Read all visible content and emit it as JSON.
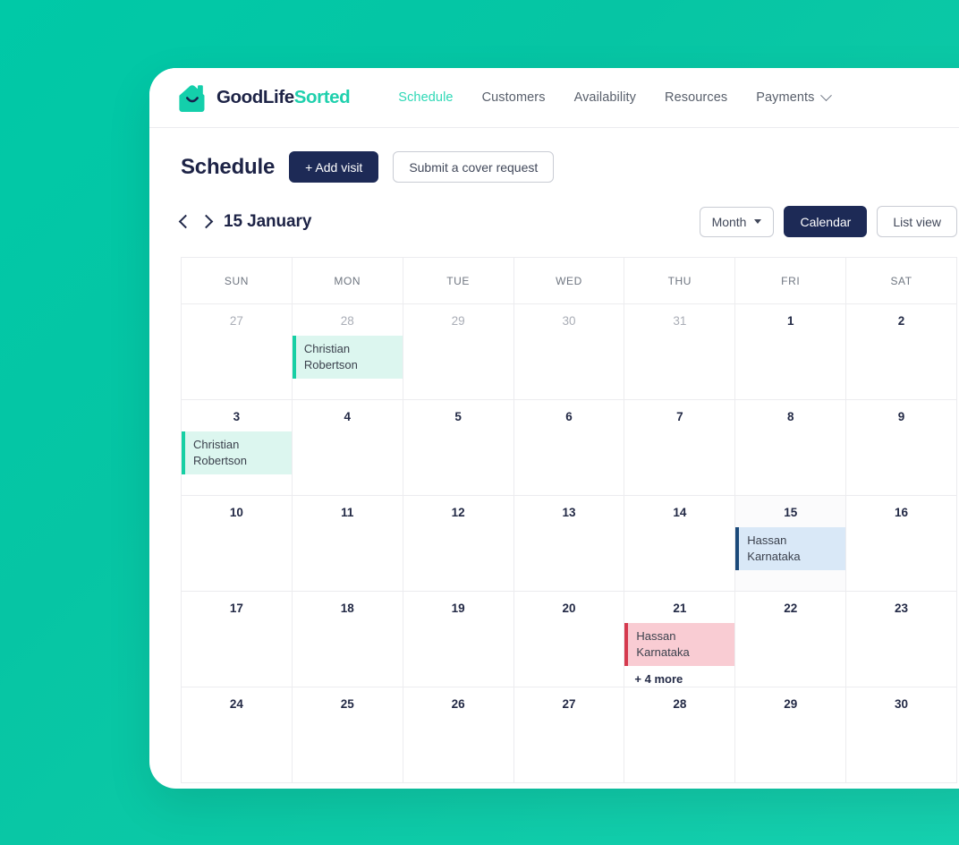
{
  "brand": {
    "name_part1": "GoodLife",
    "name_part2": "Sorted",
    "logo_icon": "house-smile-icon",
    "teal": "#1FD0AD",
    "navy": "#1d2346"
  },
  "nav": {
    "items": [
      {
        "label": "Schedule",
        "active": true
      },
      {
        "label": "Customers",
        "active": false
      },
      {
        "label": "Availability",
        "active": false
      },
      {
        "label": "Resources",
        "active": false
      },
      {
        "label": "Payments",
        "active": false,
        "caret": true
      }
    ]
  },
  "page": {
    "title": "Schedule",
    "add_visit_label": "+ Add visit",
    "cover_request_label": "Submit a cover request"
  },
  "toolbar": {
    "prev_icon": "chevron-left-icon",
    "next_icon": "chevron-right-icon",
    "date_label": "15 January",
    "month_select_label": "Month",
    "calendar_label": "Calendar",
    "list_view_label": "List view",
    "active_view": "Calendar"
  },
  "calendar": {
    "day_headers": [
      "SUN",
      "MON",
      "TUE",
      "WED",
      "THU",
      "FRI",
      "SAT"
    ],
    "weeks": [
      [
        {
          "num": "27",
          "muted": true,
          "events": []
        },
        {
          "num": "28",
          "muted": true,
          "events": [
            {
              "title": "Christian Robertson",
              "color": "teal"
            }
          ]
        },
        {
          "num": "29",
          "muted": true,
          "events": []
        },
        {
          "num": "30",
          "muted": true,
          "events": []
        },
        {
          "num": "31",
          "muted": true,
          "events": []
        },
        {
          "num": "1",
          "muted": false,
          "events": []
        },
        {
          "num": "2",
          "muted": false,
          "events": []
        }
      ],
      [
        {
          "num": "3",
          "muted": false,
          "events": [
            {
              "title": "Christian Robertson",
              "color": "teal"
            }
          ]
        },
        {
          "num": "4",
          "muted": false,
          "events": []
        },
        {
          "num": "5",
          "muted": false,
          "events": []
        },
        {
          "num": "6",
          "muted": false,
          "events": []
        },
        {
          "num": "7",
          "muted": false,
          "events": []
        },
        {
          "num": "8",
          "muted": false,
          "events": []
        },
        {
          "num": "9",
          "muted": false,
          "events": []
        }
      ],
      [
        {
          "num": "10",
          "muted": false,
          "events": []
        },
        {
          "num": "11",
          "muted": false,
          "events": []
        },
        {
          "num": "12",
          "muted": false,
          "events": []
        },
        {
          "num": "13",
          "muted": false,
          "events": []
        },
        {
          "num": "14",
          "muted": false,
          "events": []
        },
        {
          "num": "15",
          "muted": false,
          "tinted": true,
          "events": [
            {
              "title": "Hassan Karnataka",
              "color": "blue"
            }
          ]
        },
        {
          "num": "16",
          "muted": false,
          "events": []
        }
      ],
      [
        {
          "num": "17",
          "muted": false,
          "events": []
        },
        {
          "num": "18",
          "muted": false,
          "events": []
        },
        {
          "num": "19",
          "muted": false,
          "events": []
        },
        {
          "num": "20",
          "muted": false,
          "events": []
        },
        {
          "num": "21",
          "muted": false,
          "events": [
            {
              "title": "Hassan Karnataka",
              "color": "pink"
            }
          ],
          "more_label": "+ 4 more"
        },
        {
          "num": "22",
          "muted": false,
          "events": []
        },
        {
          "num": "23",
          "muted": false,
          "events": []
        }
      ],
      [
        {
          "num": "24",
          "muted": false,
          "events": []
        },
        {
          "num": "25",
          "muted": false,
          "events": []
        },
        {
          "num": "26",
          "muted": false,
          "events": []
        },
        {
          "num": "27",
          "muted": false,
          "events": []
        },
        {
          "num": "28",
          "muted": false,
          "events": []
        },
        {
          "num": "29",
          "muted": false,
          "events": []
        },
        {
          "num": "30",
          "muted": false,
          "events": []
        }
      ]
    ]
  }
}
